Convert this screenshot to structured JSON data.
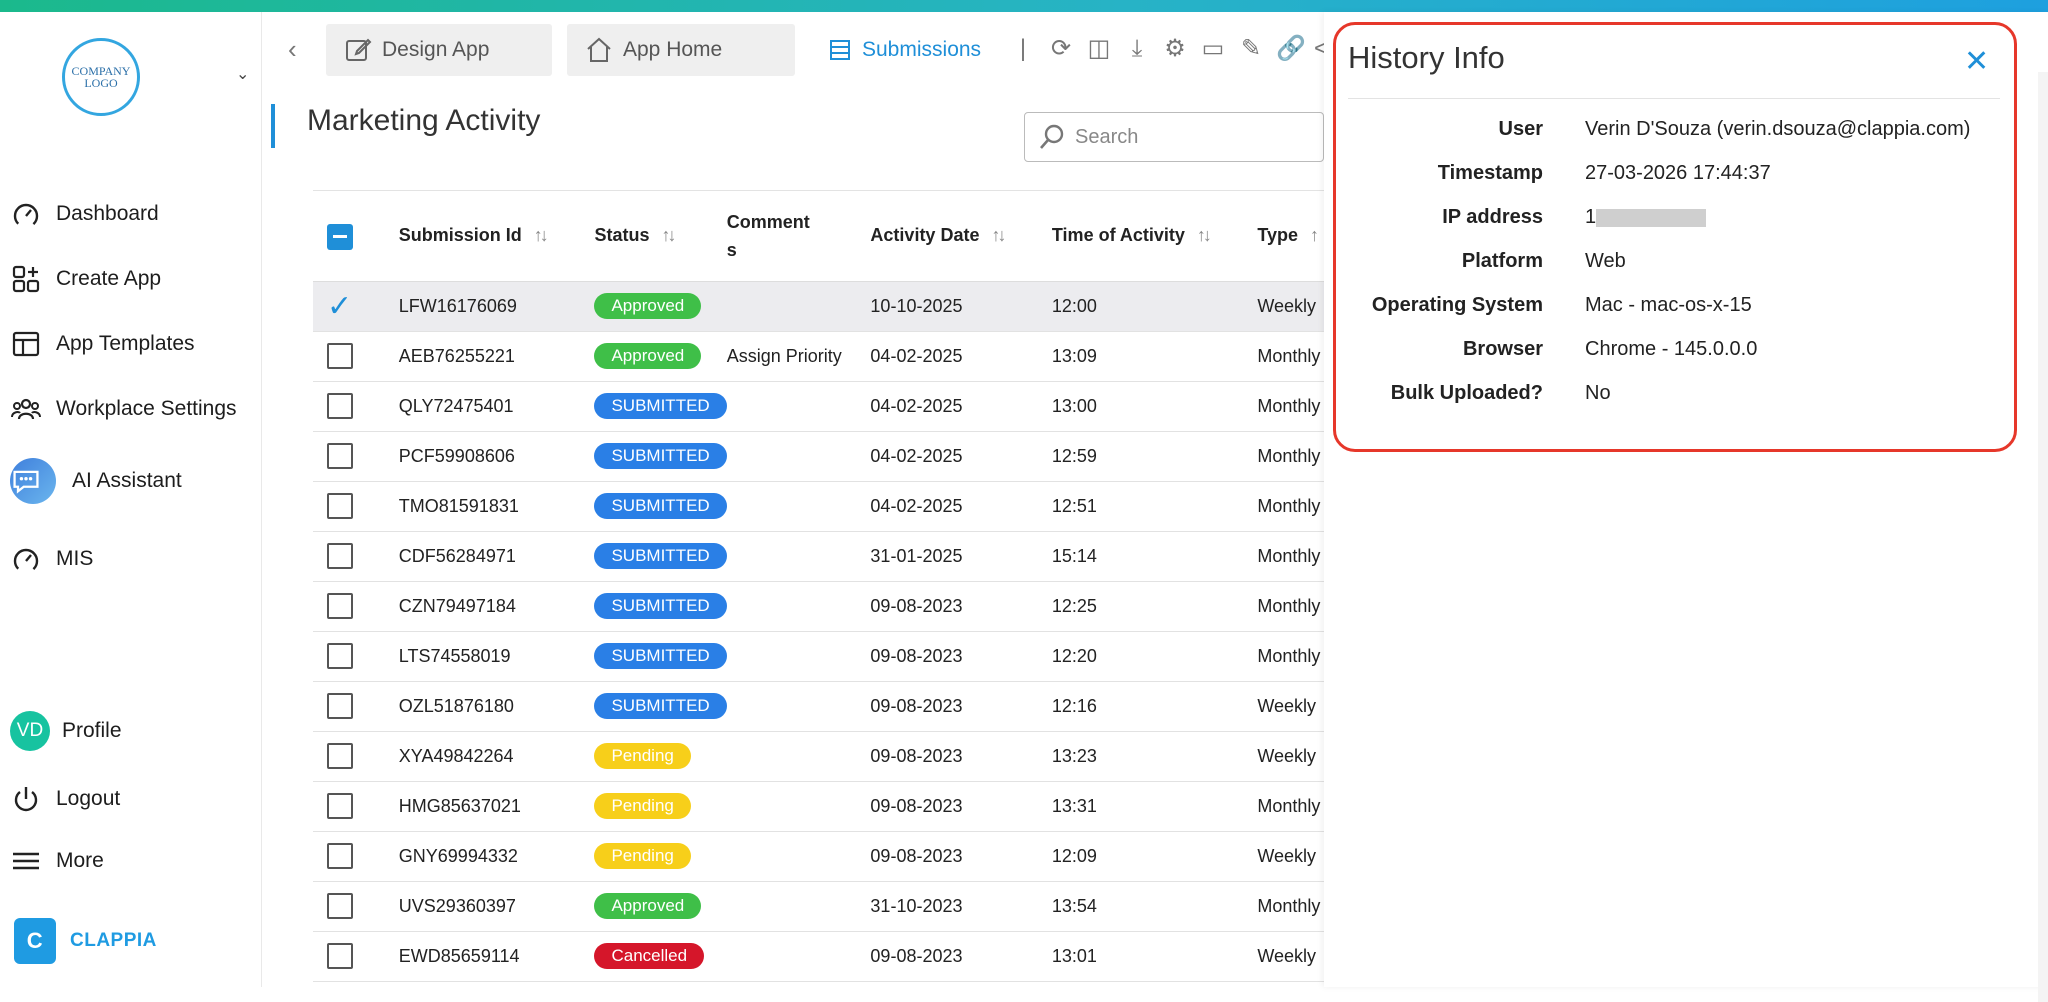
{
  "sidebar": {
    "logo_text": "COMPANY LOGO",
    "items": [
      {
        "label": "Dashboard",
        "icon": "gauge-icon"
      },
      {
        "label": "Create App",
        "icon": "grid-plus-icon"
      },
      {
        "label": "App Templates",
        "icon": "layout-icon"
      },
      {
        "label": "Workplace Settings",
        "icon": "users-icon"
      },
      {
        "label": "AI Assistant",
        "icon": "ai-chat-icon"
      },
      {
        "label": "MIS",
        "icon": "gauge-icon"
      }
    ],
    "profile": {
      "initials": "VD",
      "label": "Profile"
    },
    "logout_label": "Logout",
    "more_label": "More",
    "brand": "CLAPPIA"
  },
  "tabs": [
    {
      "label": "Design App",
      "icon": "edit-icon"
    },
    {
      "label": "App Home",
      "icon": "home-icon"
    },
    {
      "label": "Submissions",
      "icon": "list-icon"
    }
  ],
  "page": {
    "title": "Marketing Activity",
    "search_placeholder": "Search"
  },
  "table": {
    "columns": [
      "Submission Id",
      "Status",
      "Comments",
      "Activity Date",
      "Time of Activity",
      "Type"
    ],
    "comments_header": [
      "Comment",
      "s"
    ],
    "rows": [
      {
        "id": "LFW16176069",
        "status": "Approved",
        "comments": "",
        "date": "10-10-2025",
        "time": "12:00",
        "type": "Weekly"
      },
      {
        "id": "AEB76255221",
        "status": "Approved",
        "comments": "Assign Priority",
        "date": "04-02-2025",
        "time": "13:09",
        "type": "Monthly"
      },
      {
        "id": "QLY72475401",
        "status": "SUBMITTED",
        "comments": "",
        "date": "04-02-2025",
        "time": "13:00",
        "type": "Monthly"
      },
      {
        "id": "PCF59908606",
        "status": "SUBMITTED",
        "comments": "",
        "date": "04-02-2025",
        "time": "12:59",
        "type": "Monthly"
      },
      {
        "id": "TMO81591831",
        "status": "SUBMITTED",
        "comments": "",
        "date": "04-02-2025",
        "time": "12:51",
        "type": "Monthly"
      },
      {
        "id": "CDF56284971",
        "status": "SUBMITTED",
        "comments": "",
        "date": "31-01-2025",
        "time": "15:14",
        "type": "Monthly"
      },
      {
        "id": "CZN79497184",
        "status": "SUBMITTED",
        "comments": "",
        "date": "09-08-2023",
        "time": "12:25",
        "type": "Monthly"
      },
      {
        "id": "LTS74558019",
        "status": "SUBMITTED",
        "comments": "",
        "date": "09-08-2023",
        "time": "12:20",
        "type": "Monthly"
      },
      {
        "id": "OZL51876180",
        "status": "SUBMITTED",
        "comments": "",
        "date": "09-08-2023",
        "time": "12:16",
        "type": "Weekly"
      },
      {
        "id": "XYA49842264",
        "status": "Pending",
        "comments": "",
        "date": "09-08-2023",
        "time": "13:23",
        "type": "Weekly"
      },
      {
        "id": "HMG85637021",
        "status": "Pending",
        "comments": "",
        "date": "09-08-2023",
        "time": "13:31",
        "type": "Monthly"
      },
      {
        "id": "GNY69994332",
        "status": "Pending",
        "comments": "",
        "date": "09-08-2023",
        "time": "12:09",
        "type": "Weekly"
      },
      {
        "id": "UVS29360397",
        "status": "Approved",
        "comments": "",
        "date": "31-10-2023",
        "time": "13:54",
        "type": "Monthly"
      },
      {
        "id": "EWD85659114",
        "status": "Cancelled",
        "comments": "",
        "date": "09-08-2023",
        "time": "13:01",
        "type": "Weekly"
      }
    ]
  },
  "history": {
    "title": "History Info",
    "fields": [
      {
        "label": "User",
        "value": "Verin D'Souza (verin.dsouza@clappia.com)"
      },
      {
        "label": "Timestamp",
        "value": "27-03-2026 17:44:37"
      },
      {
        "label": "IP address",
        "value": "1"
      },
      {
        "label": "Platform",
        "value": "Web"
      },
      {
        "label": "Operating System",
        "value": "Mac - mac-os-x-15"
      },
      {
        "label": "Browser",
        "value": "Chrome - 145.0.0.0"
      },
      {
        "label": "Bulk Uploaded?",
        "value": "No"
      }
    ]
  },
  "colors": {
    "accent": "#1f8fd8",
    "approved": "#3fbf48",
    "submitted": "#2a7fe6",
    "pending": "#f7cf1a",
    "cancelled": "#d5162a",
    "highlight": "#e6372a"
  }
}
